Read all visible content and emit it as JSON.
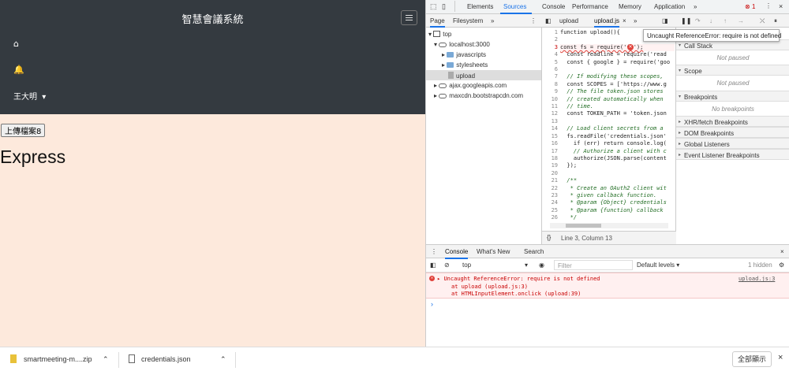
{
  "page": {
    "brand": "智慧會議系統",
    "nav": {
      "home_icon": "⌂",
      "bell_icon": "🔔",
      "user": "王大明",
      "user_caret": "▾"
    },
    "upload_button": "上傳檔案8",
    "heading": "Express"
  },
  "devtools": {
    "tabs": [
      "Elements",
      "Sources",
      "Console",
      "Performance",
      "Memory",
      "Application",
      "»"
    ],
    "active_tab": "Sources",
    "error_badge": "1",
    "navigator": {
      "tabs": [
        "Page",
        "Filesystem",
        "»"
      ],
      "tree": [
        "top",
        "localhost:3000",
        "javascripts",
        "stylesheets",
        "upload",
        "ajax.googleapis.com",
        "maxcdn.bootstrapcdn.com"
      ]
    },
    "editor": {
      "tabs": [
        "upload",
        "upload.js",
        "×",
        "»"
      ],
      "line_numbers": [
        "1",
        "2",
        "3",
        "4",
        "5",
        "6",
        "7",
        "8",
        "9",
        "10",
        "11",
        "12",
        "13",
        "14",
        "15",
        "16",
        "17",
        "18",
        "19",
        "20",
        "21",
        "22",
        "23",
        "24",
        "25",
        "26",
        "27"
      ],
      "lines": [
        "function upload(){",
        "",
        "const fs = require('fs');",
        "  const readline = require('read",
        "  const { google } = require('goo",
        "",
        "  // If modifying these scopes,",
        "  const SCOPES = ['https://www.g",
        "  // The file token.json stores",
        "  // created automatically when",
        "  // time.",
        "  const TOKEN_PATH = 'token.json",
        "",
        "  // Load client secrets from a",
        "  fs.readFile('credentials.json'",
        "    if (err) return console.log(",
        "    // Authorize a client with c",
        "    authorize(JSON.parse(content",
        "  });",
        "",
        "  /**",
        "   * Create an OAuth2 client wit",
        "   * given callback function.",
        "   * @param {Object} credentials",
        "   * @param {function} callback",
        "   */",
        ""
      ],
      "status": "Line 3, Column 13",
      "format_icon": "{}"
    },
    "tooltip": "Uncaught ReferenceError: require is not defined",
    "debugger": {
      "sections": [
        "Call Stack",
        "Scope",
        "Breakpoints",
        "XHR/fetch Breakpoints",
        "DOM Breakpoints",
        "Global Listeners",
        "Event Listener Breakpoints"
      ],
      "not_paused": "Not paused",
      "no_breakpoints": "No breakpoints"
    },
    "console": {
      "tabs": [
        "Console",
        "What's New",
        "Search"
      ],
      "context": "top",
      "filter_placeholder": "Filter",
      "levels": "Default levels ▾",
      "hidden": "1 hidden",
      "error": {
        "message": "Uncaught ReferenceError: require is not defined",
        "stack1": "at upload (upload.js:3)",
        "stack2": "at HTMLInputElement.onclick (upload:39)",
        "source": "upload.js:3"
      },
      "prompt": "›"
    }
  },
  "downloads": {
    "items": [
      "smartmeeting-m....zip",
      "credentials.json"
    ],
    "show_all": "全部顯示",
    "close": "×"
  },
  "colors": {
    "navbar": "#343a40",
    "page_bg": "#fde9dc",
    "accent": "#1a73e8",
    "error": "#c80000"
  }
}
